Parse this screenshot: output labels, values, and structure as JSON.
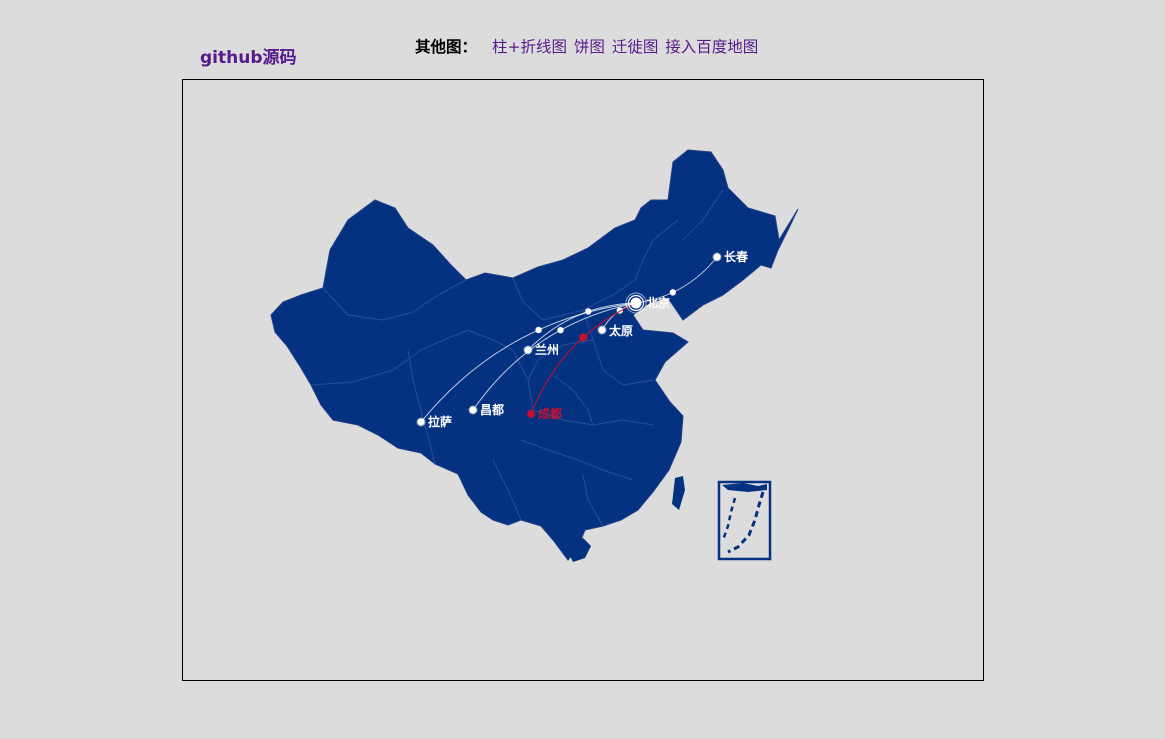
{
  "header": {
    "github_label": "github源码",
    "other_label": "其他图：",
    "links": [
      "柱+折线图",
      "饼图",
      "迁徙图",
      "接入百度地图"
    ]
  },
  "map": {
    "colors": {
      "page_bg": "#dcdcdc",
      "land": "#053181",
      "border": "#2a4d95",
      "route": "#ffffff",
      "highlight": "#c8102e"
    },
    "hub": "北京",
    "cities": [
      {
        "name": "北京",
        "role": "hub"
      },
      {
        "name": "长春"
      },
      {
        "name": "太原"
      },
      {
        "name": "兰州"
      },
      {
        "name": "昌都"
      },
      {
        "name": "拉萨"
      },
      {
        "name": "成都",
        "highlighted": true
      }
    ],
    "routes": [
      {
        "from": "长春",
        "to": "北京"
      },
      {
        "from": "太原",
        "to": "北京"
      },
      {
        "from": "兰州",
        "to": "北京"
      },
      {
        "from": "昌都",
        "to": "北京"
      },
      {
        "from": "拉萨",
        "to": "北京"
      },
      {
        "from": "成都",
        "to": "北京",
        "highlighted": true
      }
    ]
  }
}
